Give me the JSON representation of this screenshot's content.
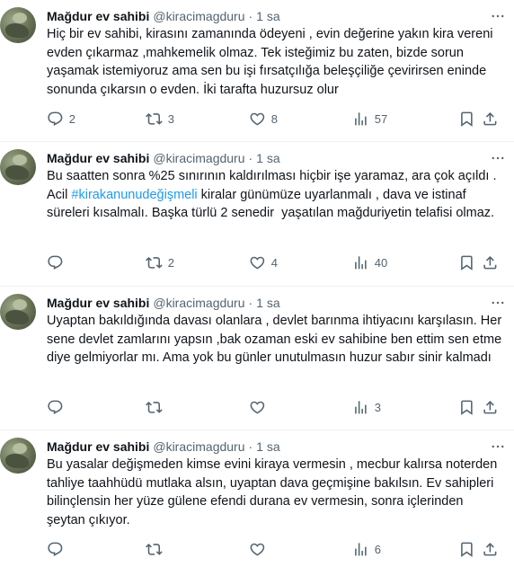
{
  "tweets": [
    {
      "name": "Mağdur ev sahibi",
      "handle": "@kiracimagduru",
      "separator": "·",
      "time": "1 sa",
      "text_before": "Hiç bir ev sahibi, kirasını zamanında ödeyeni , evin değerine yakın kira vereni evden çıkarmaz ,mahkemelik olmaz. Tek isteğimiz bu zaten, bizde sorun yaşamak istemiyoruz ama sen bu işi fırsatçılığa beleşçiliğe çevirirsen eninde sonunda çıkarsın o evden. İki tarafta huzursuz olur",
      "hashtag": "",
      "text_after": "",
      "replies": "2",
      "retweets": "3",
      "likes": "8",
      "views": "57"
    },
    {
      "name": "Mağdur ev sahibi",
      "handle": "@kiracimagduru",
      "separator": "·",
      "time": "1 sa",
      "text_before": "Bu saatten sonra %25 sınırının kaldırılması hiçbir işe yaramaz, ara çok açıldı . Acil ",
      "hashtag": "#kirakanunudeğişmeli",
      "text_after": " kiralar günümüze uyarlanmalı , dava ve istinaf süreleri kısalmalı. Başka türlü 2 senedir  yaşatılan mağduriyetin telafisi olmaz.",
      "replies": "",
      "retweets": "2",
      "likes": "4",
      "views": "40"
    },
    {
      "name": "Mağdur ev sahibi",
      "handle": "@kiracimagduru",
      "separator": "·",
      "time": "1 sa",
      "text_before": "Uyaptan bakıldığında davası olanlara , devlet barınma ihtiyacını karşılasın. Her sene devlet zamlarını yapsın ,bak ozaman eski ev sahibine ben ettim sen etme diye gelmiyorlar mı. Ama yok bu günler unutulmasın huzur sabır sinir kalmadı",
      "hashtag": "",
      "text_after": "",
      "replies": "",
      "retweets": "",
      "likes": "",
      "views": "3"
    },
    {
      "name": "Mağdur ev sahibi",
      "handle": "@kiracimagduru",
      "separator": "·",
      "time": "1 sa",
      "text_before": "Bu yasalar değişmeden kimse evini kiraya vermesin , mecbur kalırsa noterden tahliye taahhüdü mutlaka alsın, uyaptan dava geçmişine bakılsın. Ev sahipleri bilinçlensin her yüze gülene efendi durana ev vermesin, sonra içlerinden şeytan çıkıyor.",
      "hashtag": "",
      "text_after": "",
      "replies": "",
      "retweets": "",
      "likes": "",
      "views": "6"
    }
  ],
  "icons": {
    "more": "more-icon",
    "reply": "reply-icon",
    "retweet": "retweet-icon",
    "like": "like-icon",
    "views": "views-icon",
    "bookmark": "bookmark-icon",
    "share": "share-icon"
  },
  "colors": {
    "text": "#0f1419",
    "secondary": "#536471",
    "accent": "#1d9bf0",
    "divider": "#eff3f4"
  }
}
